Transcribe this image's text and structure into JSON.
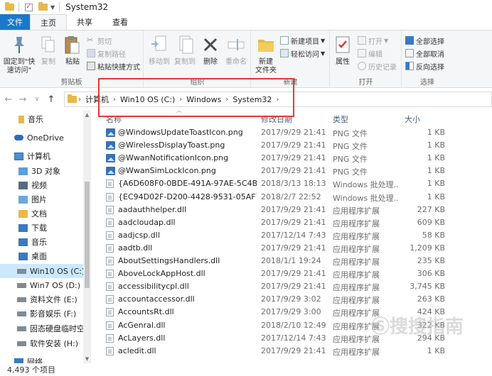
{
  "window": {
    "title": "System32"
  },
  "ribbon_tabs": [
    {
      "label": "文件"
    },
    {
      "label": "主页"
    },
    {
      "label": "共享"
    },
    {
      "label": "查看"
    }
  ],
  "ribbon": {
    "clipboard": {
      "label": "剪贴板",
      "pin": "固定到\"快速访问\"",
      "copy": "复制",
      "paste": "粘贴",
      "cut": "剪切",
      "copy_path": "复制路径",
      "paste_shortcut": "粘贴快捷方式"
    },
    "organize": {
      "label": "组织",
      "move_to": "移动到",
      "copy_to": "复制到",
      "delete": "删除",
      "rename": "重命名"
    },
    "new": {
      "label": "新建",
      "new_folder": "新建\n文件夹",
      "new_item": "新建项目",
      "easy_access": "轻松访问"
    },
    "open": {
      "label": "打开",
      "properties": "属性",
      "open": "打开",
      "edit": "编辑",
      "history": "历史记录"
    },
    "select": {
      "label": "选择",
      "select_all": "全部选择",
      "select_none": "全部取消",
      "invert": "反向选择"
    }
  },
  "address": {
    "crumbs": [
      "计算机",
      "Win10 OS (C:)",
      "Windows",
      "System32"
    ]
  },
  "sidebar": {
    "items": [
      {
        "label": "音乐",
        "icon": "music-folder-icon"
      },
      {
        "label": "OneDrive",
        "icon": "onedrive-icon"
      },
      {
        "label": "计算机",
        "icon": "computer-icon"
      },
      {
        "label": "3D 对象",
        "icon": "3d-objects-icon"
      },
      {
        "label": "视频",
        "icon": "video-folder-icon"
      },
      {
        "label": "图片",
        "icon": "pictures-folder-icon"
      },
      {
        "label": "文档",
        "icon": "documents-folder-icon"
      },
      {
        "label": "下载",
        "icon": "downloads-folder-icon"
      },
      {
        "label": "音乐",
        "icon": "music-folder-icon"
      },
      {
        "label": "桌面",
        "icon": "desktop-folder-icon"
      },
      {
        "label": "Win10 OS (C:)",
        "icon": "drive-icon",
        "selected": true
      },
      {
        "label": "Win7 OS (D:)",
        "icon": "drive-icon"
      },
      {
        "label": "资料文件 (E:)",
        "icon": "drive-icon"
      },
      {
        "label": "影音娱乐 (F:)",
        "icon": "drive-icon"
      },
      {
        "label": "固态硬盘临时空间",
        "icon": "drive-icon"
      },
      {
        "label": "软件安装 (H:)",
        "icon": "drive-icon"
      },
      {
        "label": "网络",
        "icon": "network-icon"
      }
    ]
  },
  "columns": {
    "name": "名称",
    "date": "修改日期",
    "type": "类型",
    "size": "大小"
  },
  "files": [
    {
      "name": "@WindowsUpdateToastIcon.png",
      "date": "2017/9/29 21:41",
      "type": "PNG 文件",
      "size": "1 KB",
      "icon": "png"
    },
    {
      "name": "@WirelessDisplayToast.png",
      "date": "2017/9/29 21:41",
      "type": "PNG 文件",
      "size": "1 KB",
      "icon": "png"
    },
    {
      "name": "@WwanNotificationIcon.png",
      "date": "2017/9/29 21:41",
      "type": "PNG 文件",
      "size": "1 KB",
      "icon": "png"
    },
    {
      "name": "@WwanSimLockIcon.png",
      "date": "2017/9/29 21:41",
      "type": "PNG 文件",
      "size": "1 KB",
      "icon": "png"
    },
    {
      "name": "{A6D608F0-0BDE-491A-97AE-5C4B0...",
      "date": "2018/3/13 18:13",
      "type": "Windows 批处理...",
      "size": "1 KB",
      "icon": "doc"
    },
    {
      "name": "{EC94D02F-D200-4428-9531-05AF7F...",
      "date": "2018/2/7 22:52",
      "type": "Windows 批处理...",
      "size": "1 KB",
      "icon": "doc"
    },
    {
      "name": "aadauthhelper.dll",
      "date": "2017/9/29 21:41",
      "type": "应用程序扩展",
      "size": "227 KB",
      "icon": "doc"
    },
    {
      "name": "aadcloudap.dll",
      "date": "2017/9/29 21:41",
      "type": "应用程序扩展",
      "size": "609 KB",
      "icon": "doc"
    },
    {
      "name": "aadjcsp.dll",
      "date": "2017/12/14 7:43",
      "type": "应用程序扩展",
      "size": "58 KB",
      "icon": "doc"
    },
    {
      "name": "aadtb.dll",
      "date": "2017/9/29 21:41",
      "type": "应用程序扩展",
      "size": "1,209 KB",
      "icon": "doc"
    },
    {
      "name": "AboutSettingsHandlers.dll",
      "date": "2018/1/1 19:24",
      "type": "应用程序扩展",
      "size": "235 KB",
      "icon": "doc"
    },
    {
      "name": "AboveLockAppHost.dll",
      "date": "2017/9/29 21:41",
      "type": "应用程序扩展",
      "size": "306 KB",
      "icon": "doc"
    },
    {
      "name": "accessibilitycpl.dll",
      "date": "2017/9/29 21:41",
      "type": "应用程序扩展",
      "size": "3,745 KB",
      "icon": "doc"
    },
    {
      "name": "accountaccessor.dll",
      "date": "2017/9/29 3:02",
      "type": "应用程序扩展",
      "size": "263 KB",
      "icon": "doc"
    },
    {
      "name": "AccountsRt.dll",
      "date": "2017/9/29 3:00",
      "type": "应用程序扩展",
      "size": "424 KB",
      "icon": "doc"
    },
    {
      "name": "AcGenral.dll",
      "date": "2018/2/10 12:49",
      "type": "应用程序扩展",
      "size": "322 KB",
      "icon": "doc"
    },
    {
      "name": "AcLayers.dll",
      "date": "2017/12/14 7:43",
      "type": "应用程序扩展",
      "size": "294 KB",
      "icon": "doc"
    },
    {
      "name": "acledit.dll",
      "date": "2017/9/29 21:41",
      "type": "应用程序扩展",
      "size": "1 KB",
      "icon": "doc"
    }
  ],
  "status": {
    "count": "4,493 个项目"
  },
  "watermark": {
    "text": "搜搜指南"
  },
  "colors": {
    "file_tab": "#1979ca",
    "highlight": "#e53935",
    "selected": "#cce8ff"
  }
}
